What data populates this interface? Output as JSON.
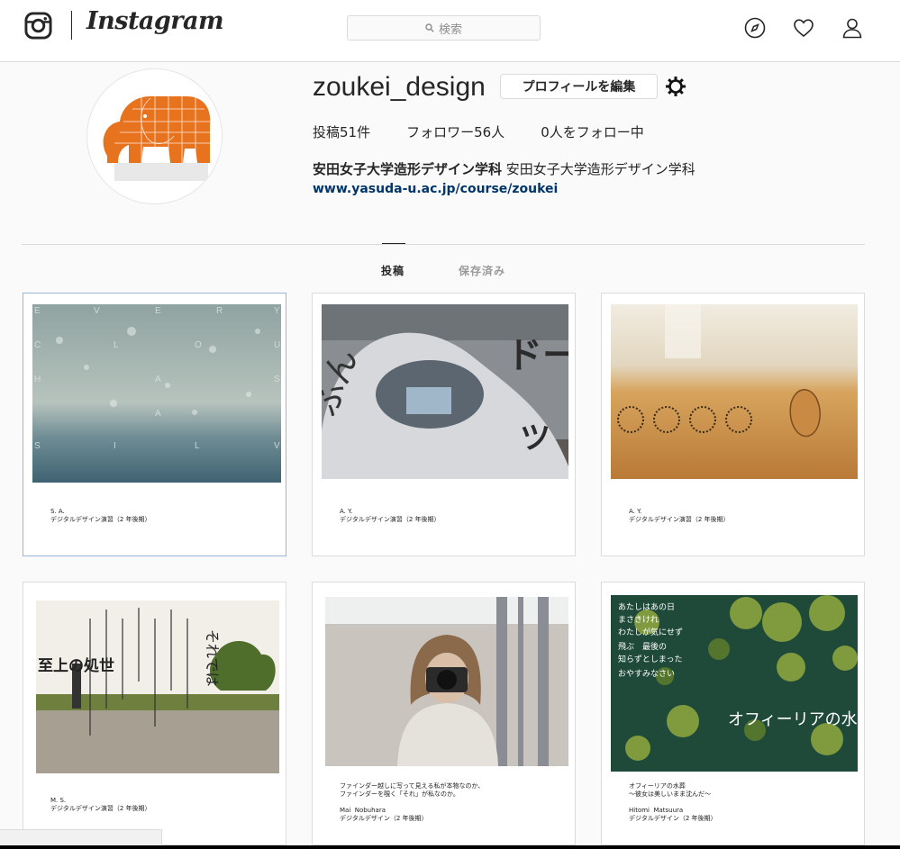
{
  "nav": {
    "wordmark": "Instagram",
    "search_placeholder": "検索",
    "icons": [
      "instagram-glyph-icon",
      "search-icon",
      "compass-icon",
      "heart-icon",
      "user-icon"
    ]
  },
  "profile": {
    "username": "zoukei_design",
    "edit_button": "プロフィールを編集",
    "stats": {
      "posts": "投稿51件",
      "followers": "フォロワー56人",
      "following": "0人をフォロー中"
    },
    "bio_name": "安田女子大学造形デザイン学科",
    "bio_text": "安田女子大学造形デザイン学科",
    "link": "www.yasuda-u.ac.jp/course/zoukei"
  },
  "tabs": [
    {
      "label": "投稿"
    },
    {
      "label": "保存済み"
    }
  ],
  "posts": [
    {
      "overlay": "EVERY CLOUD HAS A SILVER LINING",
      "caption": "S. A.\nデジタルデザイン演習（2 年後期）"
    },
    {
      "overlay": "ドーナツ",
      "caption": "A. Y.\nデジタルデザイン演習（2 年後期）"
    },
    {
      "overlay": "",
      "caption": "A. Y.\nデジタルデザイン演習（2 年後期）"
    },
    {
      "overlay": "至上の処世",
      "caption": "M. S.\nデジタルデザイン演習（2 年後期）"
    },
    {
      "overlay": "",
      "caption": "ファインダー越しに写って見える私が本物なのか、\nファインダーを覗く「それ」が私なのか。\n\nMai  Nobuhara\nデジタルデザイン（2 年後期）"
    },
    {
      "overlay": "オフィーリアの水葬",
      "caption": "オフィーリアの水葬\n～彼女は美しいまま沈んだ～\n\nHitomi  Matsuura\nデジタルデザイン（2 年後期）"
    }
  ],
  "colors": {
    "link": "#003569",
    "elephant": "#e8731f",
    "border": "#dbdbdb"
  }
}
